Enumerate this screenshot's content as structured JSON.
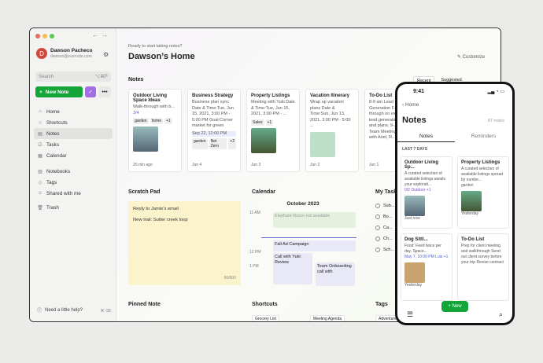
{
  "colors": {
    "accent_green": "#13a538",
    "avatar_red": "#d0473b",
    "scratch_yellow": "#fbf3cc",
    "purple": "#a26fe3"
  },
  "account": {
    "initial": "D",
    "name": "Dawson Pacheco",
    "email": "dawson@evernote.com"
  },
  "sidebar": {
    "search_placeholder": "Search",
    "search_shortcut": "⌥⌘F",
    "new_note": "New Note",
    "items": [
      {
        "label": "Home",
        "icon": "home-icon"
      },
      {
        "label": "Shortcuts",
        "icon": "star-icon"
      },
      {
        "label": "Notes",
        "icon": "note-icon"
      },
      {
        "label": "Tasks",
        "icon": "check-icon"
      },
      {
        "label": "Calendar",
        "icon": "calendar-icon"
      },
      {
        "label": "Notebooks",
        "icon": "notebook-icon"
      },
      {
        "label": "Tags",
        "icon": "tag-icon"
      },
      {
        "label": "Shared with me",
        "icon": "people-icon"
      },
      {
        "label": "Trash",
        "icon": "trash-icon"
      }
    ],
    "help": "Need a little help?"
  },
  "main": {
    "subtitle": "Ready to start taking notes?",
    "title": "Dawson’s Home",
    "customize": "Customize",
    "notes_title": "Notes",
    "tabs": [
      "Recent",
      "Suggested"
    ],
    "cards": [
      {
        "title": "Outdoor Living Space Ideas",
        "text": "Walk-through with b...",
        "meta": "3/4",
        "tags": [
          "garden",
          "home",
          "+1"
        ],
        "date": "20 min ago"
      },
      {
        "title": "Business Strategy",
        "text": "Business plan sync Date & Time:Tue, Jun 15, 2021, 3:00 PM - 5:00 PM Goal:Corner market for green",
        "meta": "Sep 22, 12:00 PM",
        "tags": [
          "garden",
          "Net Zero",
          "+2"
        ],
        "date": "Jun 4"
      },
      {
        "title": "Property Listings",
        "text": "Meeting with Yuki Date & Time:Tue, Jun 15, 2021, 3:00 PM - ...",
        "meta": "",
        "tags": [
          "Sales",
          "+1"
        ],
        "date": "Jun 3"
      },
      {
        "title": "Vacation Itinerary",
        "text": "Wrap up vacation plans Date & Time:Sun, Jun 13, 2021, 3:00 PM - 5:00 ...",
        "meta": "",
        "tags": [],
        "date": "Jun 2"
      },
      {
        "title": "To-Do List",
        "text": "8-9 am Lead Generation F... through on existing lead generation and plans. 9-... Team Meeting in with Ariel, R...",
        "meta": "",
        "tags": [],
        "date": "Jun 1"
      }
    ],
    "scratch_title": "Scratch Pad",
    "scratch_lines": [
      "Reply to Jamie's email",
      "New trail: Sutter creek loop"
    ],
    "scratch_count": "50/600",
    "calendar_title": "Calendar",
    "calendar_month": "October 2023",
    "calendar_times": [
      "11 AM",
      "12 PM",
      "1 PM"
    ],
    "calendar_events": [
      "Elephant Room not available",
      "Fall Ad Campaign",
      "Call with Yuki: Review",
      "Team Onboarding call with"
    ],
    "tasks_title": "My Tasks",
    "tasks": [
      "Sub...",
      "Bo...",
      "Ca...",
      "Ch...",
      "Sch..."
    ],
    "pinned_title": "Pinned Note",
    "shortcuts_title": "Shortcuts",
    "shortcuts": [
      "Grocery List",
      "Meeting Agenda"
    ],
    "tags_title": "Tags",
    "tags_first": "Adventure"
  },
  "phone": {
    "time": "9:41",
    "back": "Home",
    "title": "Notes",
    "count": "87 notes",
    "tabs": [
      "Notes",
      "Reminders"
    ],
    "section": "LAST 7 DAYS",
    "cards": [
      {
        "title": "Outdoor Living Sp...",
        "text": "A curated selection of available listings awaits your explorati...",
        "meta": "0/2  Outdoor  +1",
        "date": "Just now"
      },
      {
        "title": "Property Listings",
        "text": "A curated selection of available listings spread by numbe...",
        "meta": "garden",
        "date": "Yesterday"
      },
      {
        "title": "Dog Sitti...",
        "text": "Food: Feed twice per day. Space...",
        "meta": "May 7, 10:00 PM  Luis  +1",
        "date": "Yesterday"
      },
      {
        "title": "To-Do List",
        "text": "Prep for client meeting and walkthrough Send out client survey before your trip Revise contract",
        "meta": "",
        "date": ""
      }
    ],
    "add": "New"
  }
}
